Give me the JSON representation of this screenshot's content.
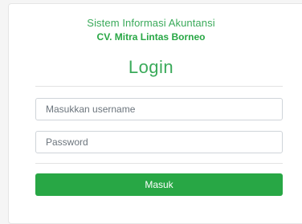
{
  "header": {
    "subtitle": "Sistem Informasi Akuntansi",
    "company": "CV. Mitra Lintas Borneo",
    "title": "Login"
  },
  "form": {
    "username_placeholder": "Masukkan username",
    "username_value": "",
    "password_placeholder": "Password",
    "password_value": "",
    "submit_label": "Masuk"
  },
  "colors": {
    "accent": "#28a745",
    "text_green": "#3aaa5a",
    "background": "#f5f5f5",
    "card": "#ffffff"
  }
}
